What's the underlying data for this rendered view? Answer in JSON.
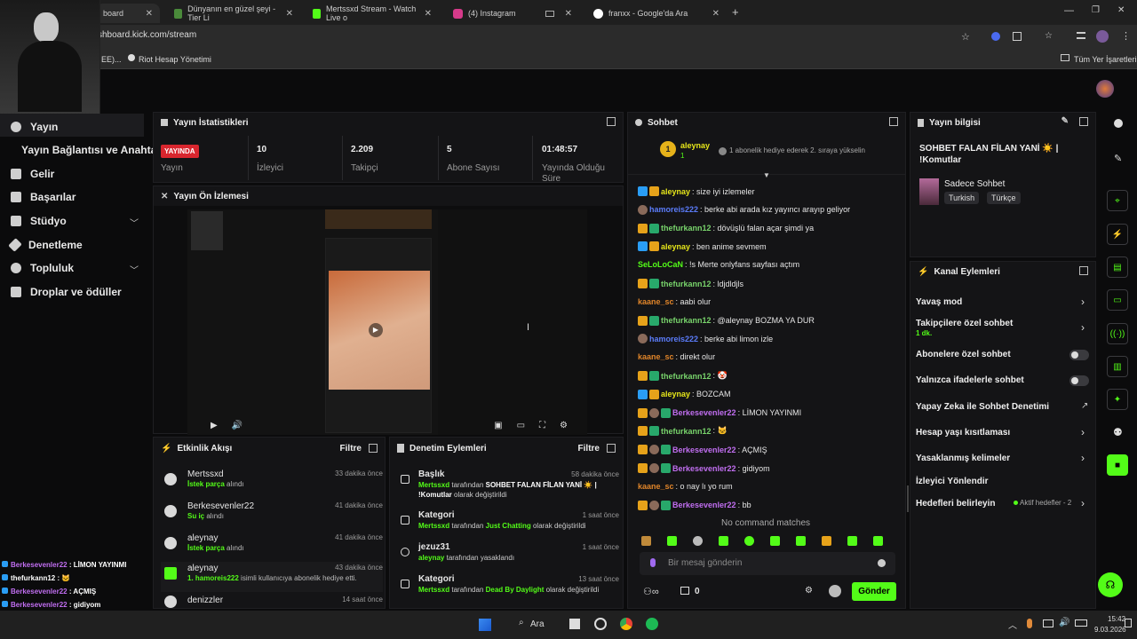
{
  "browser": {
    "tabs": [
      {
        "label": "board",
        "color": "#2a2a2a"
      },
      {
        "label": "Dünyanın en güzel şeyi - Tier Li",
        "color": "#4a8a3a"
      },
      {
        "label": "Mertssxd Stream - Watch Live o",
        "color": "#53fc18"
      },
      {
        "label": "(4) Instagram",
        "color": "#d63a8a"
      },
      {
        "label": "franxx - Google'da Ara",
        "color": "#4285f4"
      }
    ],
    "url": "shboard.kick.com/stream",
    "bookmarks": [
      "EE)...",
      "Riot Hesap Yönetimi"
    ],
    "all_bookmarks": "Tüm Yer İşaretleri"
  },
  "sidebar": {
    "items": [
      {
        "label": "Yayın"
      },
      {
        "label": "Yayın Bağlantısı ve Anahtarı"
      },
      {
        "label": "Gelir"
      },
      {
        "label": "Başarılar"
      },
      {
        "label": "Stüdyo"
      },
      {
        "label": "Denetleme"
      },
      {
        "label": "Topluluk"
      },
      {
        "label": "Droplar ve ödüller"
      }
    ]
  },
  "stats": {
    "title": "Yayın İstatistikleri",
    "live_badge": "YAYINDA",
    "items": [
      {
        "value": "",
        "label": "Yayın"
      },
      {
        "value": "10",
        "label": "İzleyici"
      },
      {
        "value": "2.209",
        "label": "Takipçi"
      },
      {
        "value": "5",
        "label": "Abone Sayısı"
      },
      {
        "value": "01:48:57",
        "label": "Yayında Olduğu Süre"
      }
    ]
  },
  "preview": {
    "title": "Yayın Ön İzlemesi"
  },
  "activity": {
    "title": "Etkinlik Akışı",
    "filter": "Filtre",
    "rows": [
      {
        "name": "Mertssxd",
        "action": "İstek parça",
        "suffix": "alındı",
        "time": "33 dakika önce"
      },
      {
        "name": "Berkesevenler22",
        "action": "Su iç",
        "suffix": "alındı",
        "time": "41 dakika önce"
      },
      {
        "name": "aleynay",
        "action": "İstek parça",
        "suffix": "alındı",
        "time": "41 dakika önce"
      },
      {
        "name": "aleynay",
        "action": "1. hamoreis222",
        "suffix": "isimli kullanıcıya abonelik hediye etti.",
        "time": "43 dakika önce"
      },
      {
        "name": "denizzler",
        "action": "",
        "suffix": "",
        "time": "14 saat önce"
      }
    ]
  },
  "moderation": {
    "title": "Denetim Eylemleri",
    "filter": "Filtre",
    "rows": [
      {
        "title": "Başlık",
        "time": "58 dakika önce",
        "user": "Mertssxd",
        "mid": "tarafından",
        "value": "SOHBET FALAN FİLAN YANİ ☀️ | !Komutlar",
        "end": "olarak değiştirildi"
      },
      {
        "title": "Kategori",
        "time": "1 saat önce",
        "user": "Mertssxd",
        "mid": "tarafından",
        "value": "Just Chatting",
        "end": "olarak değiştirildi"
      },
      {
        "title": "jezuz31",
        "time": "1 saat önce",
        "user": "aleynay",
        "mid": "tarafından yasaklandı",
        "value": "",
        "end": ""
      },
      {
        "title": "Kategori",
        "time": "13 saat önce",
        "user": "Mertssxd",
        "mid": "tarafından",
        "value": "Dead By Daylight",
        "end": "olarak değiştirildi"
      }
    ]
  },
  "chat": {
    "title": "Sohbet",
    "pinned_user": "aleynay",
    "pinned_count": "1",
    "pinned_rank": "1",
    "pinned_text": "1 abonelik hediye ederek 2. sıraya yükselin",
    "messages": [
      {
        "user": "aleynay",
        "text": ": size iyi izlemeler",
        "cls": "u-y",
        "badges": [
          "b-mod",
          "b-vip"
        ]
      },
      {
        "user": "hamoreis222",
        "text": ": berke abi arada kız yayıncı arayıp geliyor",
        "cls": "u-b",
        "badges": [
          "b-gift"
        ]
      },
      {
        "user": "thefurkann12",
        "text": ": dövüşlü falan açar şimdi ya",
        "cls": "u-c",
        "badges": [
          "b-vip",
          "b-sub"
        ]
      },
      {
        "user": "aleynay",
        "text": ": ben anime sevmem",
        "cls": "u-y",
        "badges": [
          "b-mod",
          "b-vip"
        ]
      },
      {
        "user": "SeLoLoCaN",
        "text": ": !s Merte onlyfans sayfası açtım",
        "cls": "u-g",
        "badges": []
      },
      {
        "user": "thefurkann12",
        "text": ": ldjdldjls",
        "cls": "u-c",
        "badges": [
          "b-vip",
          "b-sub"
        ]
      },
      {
        "user": "kaane_sc",
        "text": ": aabi olur",
        "cls": "u-o",
        "badges": []
      },
      {
        "user": "thefurkann12",
        "text": ": @aleynay BOZMA YA DUR",
        "cls": "u-c",
        "badges": [
          "b-vip",
          "b-sub"
        ]
      },
      {
        "user": "hamoreis222",
        "text": ": berke abi limon izle",
        "cls": "u-b",
        "badges": [
          "b-gift"
        ]
      },
      {
        "user": "kaane_sc",
        "text": ": direkt olur",
        "cls": "u-o",
        "badges": []
      },
      {
        "user": "thefurkann12",
        "text": ": 🤡",
        "cls": "u-c",
        "badges": [
          "b-vip",
          "b-sub"
        ]
      },
      {
        "user": "aleynay",
        "text": ": BOZCAM",
        "cls": "u-y",
        "badges": [
          "b-mod",
          "b-vip"
        ]
      },
      {
        "user": "Berkesevenler22",
        "text": ": LİMON YAYINMI",
        "cls": "u-p",
        "badges": [
          "b-vip",
          "b-gift",
          "b-sub"
        ]
      },
      {
        "user": "thefurkann12",
        "text": ": 🐱",
        "cls": "u-c",
        "badges": [
          "b-vip",
          "b-sub"
        ]
      },
      {
        "user": "Berkesevenler22",
        "text": ": AÇMIŞ",
        "cls": "u-p",
        "badges": [
          "b-vip",
          "b-gift",
          "b-sub"
        ]
      },
      {
        "user": "Berkesevenler22",
        "text": ": gidiyom",
        "cls": "u-p",
        "badges": [
          "b-vip",
          "b-gift",
          "b-sub"
        ]
      },
      {
        "user": "kaane_sc",
        "text": ": o nay lı yo rum",
        "cls": "u-o",
        "badges": []
      },
      {
        "user": "Berkesevenler22",
        "text": ": bb",
        "cls": "u-p",
        "badges": [
          "b-vip",
          "b-gift",
          "b-sub"
        ]
      }
    ],
    "no_command": "No command matches",
    "input_placeholder": "Bir mesaj gönderin",
    "points": "0",
    "send": "Gönder"
  },
  "stream_info": {
    "title": "Yayın bilgisi",
    "stream_title": "SOHBET FALAN FİLAN YANİ ☀️ | !Komutlar",
    "category": "Sadece Sohbet",
    "tags": [
      "Turkish",
      "Türkçe"
    ]
  },
  "channel_actions": {
    "title": "Kanal Eylemleri",
    "slow_mode": "Yavaş mod",
    "followers_only": "Takipçilere özel sohbet",
    "followers_value": "1 dk.",
    "subs_only": "Abonelere özel sohbet",
    "emotes_only": "Yalnızca ifadelerle sohbet",
    "ai_mod": "Yapay Zeka ile Sohbet Denetimi",
    "age": "Hesap yaşı kısıtlaması",
    "banned_words": "Yasaklanmış kelimeler",
    "viewer_redirect": "İzleyici Yönlendir",
    "goals": "Hedefleri belirleyin",
    "goals_status": "Aktif hedefler - 2"
  },
  "overlay": {
    "lines": [
      {
        "user": "Berkesevenler22",
        "text": " : LİMON YAYINMI"
      },
      {
        "user": "thefurkann12",
        "text": " : 🐱"
      },
      {
        "user": "Berkesevenler22",
        "text": " : AÇMIŞ"
      },
      {
        "user": "Berkesevenler22",
        "text": " : gidiyom"
      },
      {
        "user": "kaane_sc",
        "text": " : o nay lı yo rum"
      },
      {
        "user": "Berkesevenler22",
        "text": " : bb"
      }
    ]
  },
  "taskbar": {
    "search": "Ara",
    "time": "15:42",
    "date": "9.03.2026"
  }
}
